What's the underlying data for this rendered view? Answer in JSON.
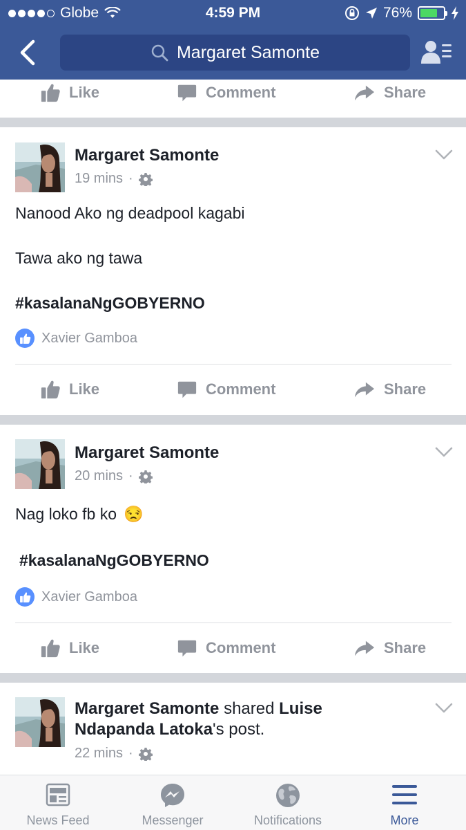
{
  "status_bar": {
    "carrier": "Globe",
    "time": "4:59 PM",
    "battery": "76%",
    "battery_level": 0.76
  },
  "search": {
    "value": "Margaret Samonte"
  },
  "actions": {
    "like": "Like",
    "comment": "Comment",
    "share": "Share"
  },
  "posts": [
    {
      "author": "Margaret Samonte",
      "time": "19 mins",
      "lines": [
        "Nanood Ako ng deadpool kagabi",
        "Tawa ako ng tawa",
        "#kasalanaNgGOBYERNO"
      ],
      "liked_by": "Xavier Gamboa"
    },
    {
      "author": "Margaret Samonte",
      "time": "20 mins",
      "lines": [
        "Nag loko fb ko",
        "#kasalanaNgGOBYERNO"
      ],
      "emoji": "😒",
      "liked_by": "Xavier Gamboa"
    },
    {
      "author": "Margaret Samonte",
      "shared_word": "shared",
      "shared_from": "Luise Ndapanda Latoka",
      "shared_suffix": "'s post.",
      "time": "22 mins"
    }
  ],
  "tabbar": {
    "tabs": [
      {
        "label": "News Feed",
        "icon": "news-feed-icon"
      },
      {
        "label": "Messenger",
        "icon": "messenger-icon"
      },
      {
        "label": "Notifications",
        "icon": "globe-icon"
      },
      {
        "label": "More",
        "icon": "menu-icon"
      }
    ],
    "active": "More",
    "accent": "#3b5998"
  },
  "colors": {
    "header": "#3b5998",
    "search_bg": "#2c4584",
    "like_badge": "#5890ff",
    "muted": "#90949c"
  }
}
